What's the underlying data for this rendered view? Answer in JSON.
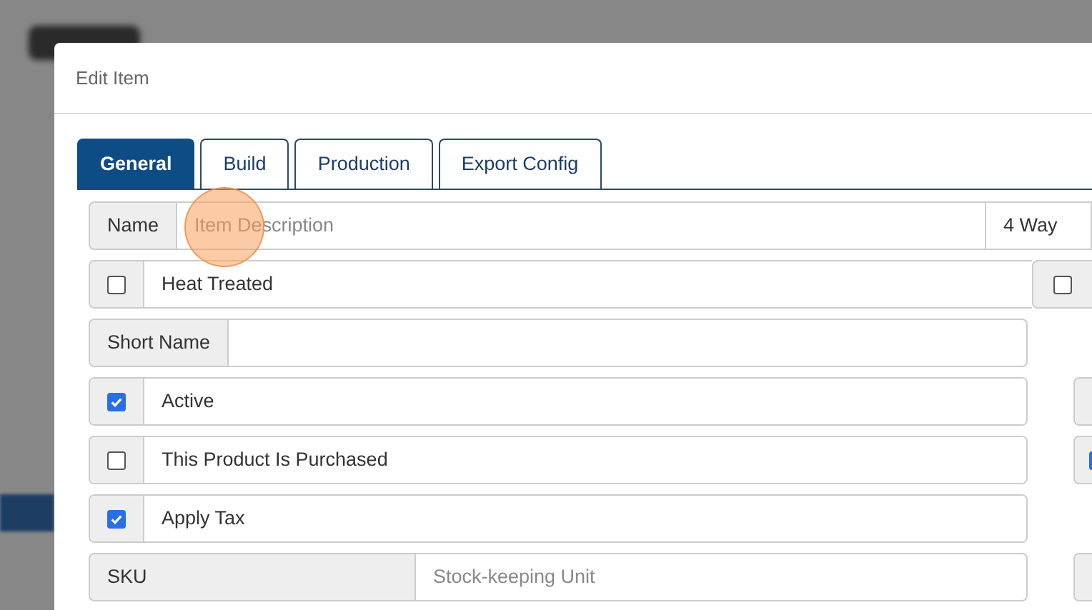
{
  "dialog": {
    "title": "Edit Item"
  },
  "tabs": [
    {
      "label": "General",
      "selected": true
    },
    {
      "label": "Build",
      "selected": false
    },
    {
      "label": "Production",
      "selected": false
    },
    {
      "label": "Export Config",
      "selected": false
    }
  ],
  "rows": [
    {
      "kind": "text",
      "label": "Name",
      "placeholder": "Item Description",
      "focused": true,
      "extra_value": "4 Way"
    },
    {
      "kind": "checkbox",
      "label": "Heat Treated",
      "checked": false,
      "side": {
        "kind": "checkbox",
        "checked": false
      }
    },
    {
      "kind": "text",
      "label": "Short Name"
    },
    {
      "kind": "checkbox",
      "label": "Active",
      "checked": true,
      "side": {
        "kind": "addon"
      }
    },
    {
      "kind": "checkbox",
      "label": "This Product Is Purchased",
      "checked": false,
      "side": {
        "kind": "checkbox-edge",
        "checked": true
      }
    },
    {
      "kind": "checkbox",
      "label": "Apply Tax",
      "checked": true
    },
    {
      "kind": "wide-text",
      "label": "SKU",
      "placeholder": "Stock-keeping Unit",
      "side": {
        "kind": "addon"
      }
    }
  ]
}
